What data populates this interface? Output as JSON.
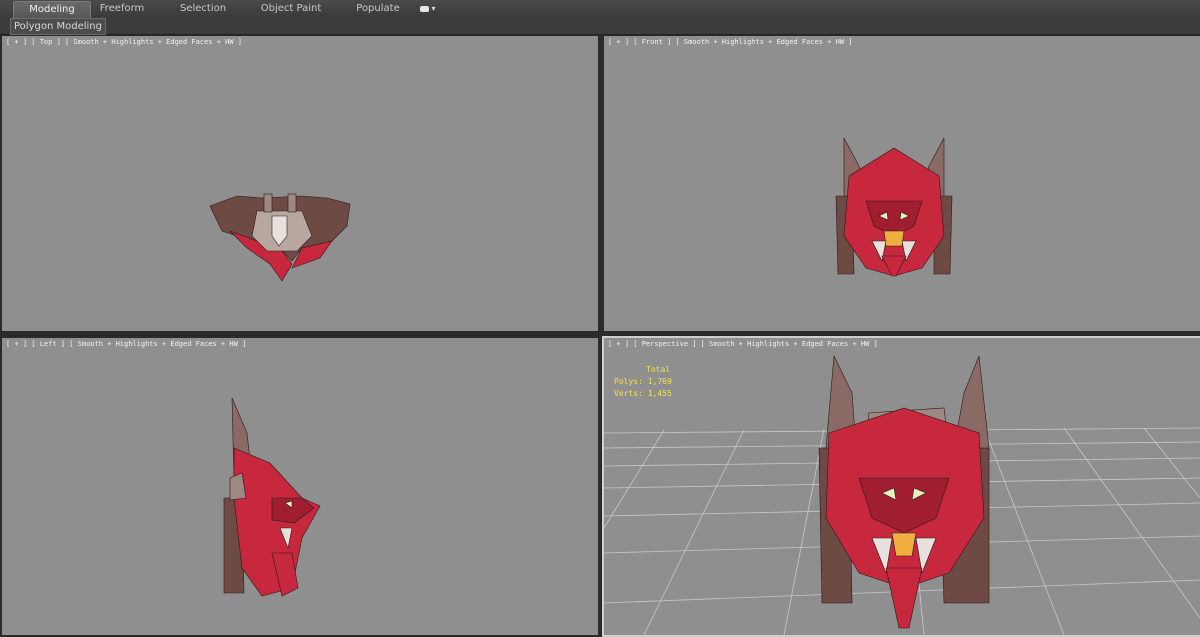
{
  "ribbon": {
    "tabs": [
      {
        "label": "Modeling",
        "active": true
      },
      {
        "label": "Freeform",
        "active": false
      },
      {
        "label": "Selection",
        "active": false
      },
      {
        "label": "Object Paint",
        "active": false
      },
      {
        "label": "Populate",
        "active": false
      }
    ]
  },
  "subbar": {
    "panel_label": "Polygon Modeling"
  },
  "viewports": {
    "top": {
      "label": "[ + ] [ Top ] [ Smooth + Highlights + Edged Faces + HW ]"
    },
    "front": {
      "label": "[ + ] [ Front ] [ Smooth + Highlights + Edged Faces + HW ]"
    },
    "left": {
      "label": "[ + ] [ Left ] [ Smooth + Highlights + Edged Faces + HW ]"
    },
    "perspective": {
      "label": "[ + ] [ Perspective ] [ Smooth + Highlights + Edged Faces + HW ]"
    }
  },
  "stats": {
    "header": "Total",
    "polys_label": "Polys:",
    "polys_value": "1,769",
    "verts_label": "Verts:",
    "verts_value": "1,455"
  },
  "colors": {
    "viewport_bg": "#8f8f8f",
    "stats_text": "#f2e24a",
    "model_red": "#c8283e",
    "model_brown": "#6e4a44"
  }
}
